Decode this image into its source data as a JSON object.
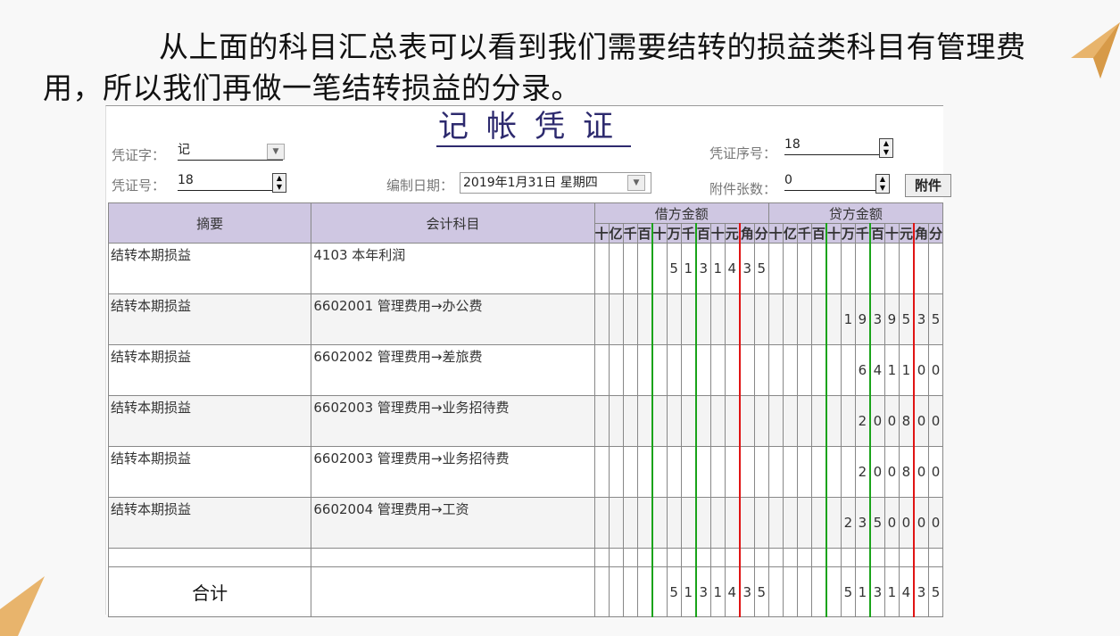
{
  "caption": "从上面的科目汇总表可以看到我们需要结转的损益类科目有管理费用，所以我们再做一笔结转损益的分录。",
  "voucher": {
    "title": "记帐凭证",
    "word_label": "凭证字：",
    "word_value": "记",
    "number_label": "凭证号：",
    "number_value": "18",
    "date_label": "编制日期：",
    "date_value": "2019年1月31日  星期四",
    "seq_label": "凭证序号：",
    "seq_value": "18",
    "attach_label": "附件张数：",
    "attach_value": "0",
    "attach_button": "附件"
  },
  "table": {
    "col_summary": "摘要",
    "col_account": "会计科目",
    "col_debit": "借方金额",
    "col_credit": "贷方金额",
    "digit_headers": [
      "十",
      "亿",
      "千",
      "百",
      "十",
      "万",
      "千",
      "百",
      "十",
      "元",
      "角",
      "分"
    ],
    "rows": [
      {
        "summary": "结转本期损益",
        "account": "4103  本年利润",
        "debit": "5131435",
        "credit": ""
      },
      {
        "summary": "结转本期损益",
        "account": "6602001  管理费用→办公费",
        "debit": "",
        "credit": "1939535"
      },
      {
        "summary": "结转本期损益",
        "account": "6602002  管理费用→差旅费",
        "debit": "",
        "credit": "641100"
      },
      {
        "summary": "结转本期损益",
        "account": "6602003  管理费用→业务招待费",
        "debit": "",
        "credit": "200800"
      },
      {
        "summary": "结转本期损益",
        "account": "6602003  管理费用→业务招待费",
        "debit": "",
        "credit": "200800"
      },
      {
        "summary": "结转本期损益",
        "account": "6602004  管理费用→工资",
        "debit": "",
        "credit": "2350000"
      }
    ],
    "total_label": "合计",
    "total_debit": "5131435",
    "total_credit": "5131435"
  },
  "colors": {
    "header_bg": "#cfc7e2",
    "title": "#2d2a6e",
    "green_line": "#1aa31a",
    "red_line": "#e01414",
    "accent_deco": "#e8b46c"
  }
}
